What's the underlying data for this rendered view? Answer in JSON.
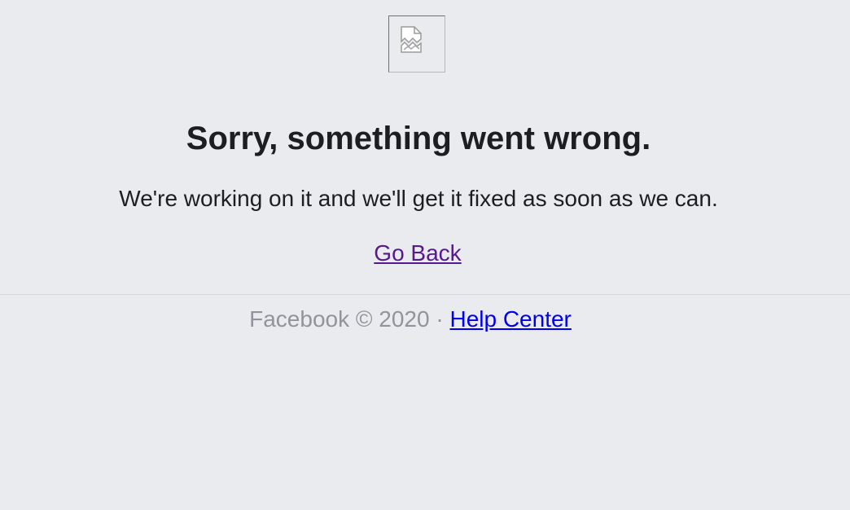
{
  "error": {
    "image_icon": "broken-image-icon",
    "title": "Sorry, something went wrong.",
    "message": "We're working on it and we'll get it fixed as soon as we can.",
    "go_back_label": "Go Back"
  },
  "footer": {
    "copyright": "Facebook © 2020",
    "separator": "·",
    "help_center_label": "Help Center"
  },
  "colors": {
    "background": "#e9ebee",
    "visited_link": "#551a8b",
    "link": "#0000ee",
    "muted_text": "#90949c"
  }
}
